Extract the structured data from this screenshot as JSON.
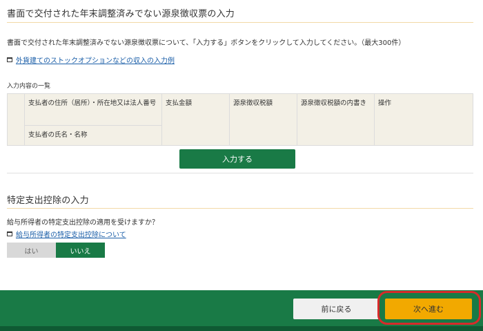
{
  "section1": {
    "title": "書面で交付された年末調整済みでない源泉徴収票の入力",
    "description": "書面で交付された年末調整済みでない源泉徴収票について、「入力する」ボタンをクリックして入力してください。（最大300件）",
    "example_link": "外貨建てのストックオプションなどの収入の入力例",
    "list_label": "入力内容の一覧",
    "table": {
      "col_payer_address": "支払者の住所（居所）・所在地又は法人番号",
      "col_payer_name": "支払者の氏名・名称",
      "col_amount": "支払金額",
      "col_tax": "源泉徴収税額",
      "col_tax_breakdown": "源泉徴収税額の内書き",
      "col_action": "操作"
    },
    "input_button": "入力する"
  },
  "section2": {
    "title": "特定支出控除の入力",
    "question": "給与所得者の特定支出控除の適用を受けますか？",
    "info_link": "給与所得者の特定支出控除について",
    "options": [
      "はい",
      "いいえ"
    ],
    "selected": "いいえ"
  },
  "footer": {
    "back_label": "前に戻る",
    "next_label": "次へ進む"
  },
  "colors": {
    "primary_green": "#197a46",
    "next_button": "#f2a900",
    "highlight_ring": "#d72b2b",
    "title_rule": "#f2d9a6"
  }
}
